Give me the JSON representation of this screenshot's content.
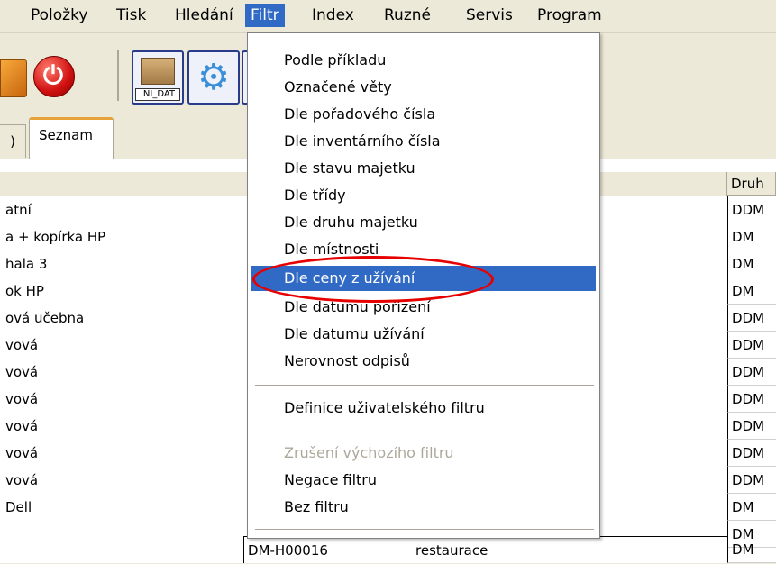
{
  "menubar": {
    "items": [
      "Položky",
      "Tisk",
      "Hledání",
      "Filtr",
      "Index",
      "Ruzné",
      "Servis",
      "Program"
    ]
  },
  "toolbar": {
    "ini_label": "INI_DAT"
  },
  "tabs": {
    "left_partial": ")",
    "active": "Seznam"
  },
  "grid": {
    "druh_header": "Druh",
    "rows": [
      {
        "name": "atní",
        "druh": "DDM"
      },
      {
        "name": "a + kopírka HP",
        "druh": "DM"
      },
      {
        "name": "hala 3",
        "druh": "DM"
      },
      {
        "name": "ok HP",
        "druh": "DM"
      },
      {
        "name": "ová učebna",
        "druh": "DDM"
      },
      {
        "name": "vová",
        "druh": "DDM"
      },
      {
        "name": "vová",
        "druh": "DDM"
      },
      {
        "name": "vová",
        "druh": "DDM"
      },
      {
        "name": "vová",
        "druh": "DDM"
      },
      {
        "name": "vová",
        "druh": "DDM"
      },
      {
        "name": "vová",
        "druh": "DDM"
      },
      {
        "name": "Dell",
        "druh": "DM"
      },
      {
        "name": "",
        "druh": "DM"
      }
    ],
    "last_row": {
      "code": "DM-H00016",
      "place": "restaurace",
      "druh": "DM"
    }
  },
  "filter_menu": {
    "items": [
      "Podle příkladu",
      "Označené věty",
      "Dle pořadového čísla",
      "Dle inventárního čísla",
      "Dle stavu majetku",
      "Dle třídy",
      "Dle druhu majetku",
      "Dle místnosti",
      "Dle ceny z užívání",
      "Dle datumu pořízení",
      "Dle datumu užívání",
      "Nerovnost odpisů"
    ],
    "user_filter": "Definice uživatelského filtru",
    "cancel_default": "Zrušení výchozího filtru",
    "negate": "Negace filtru",
    "no_filter": "Bez filtru"
  }
}
